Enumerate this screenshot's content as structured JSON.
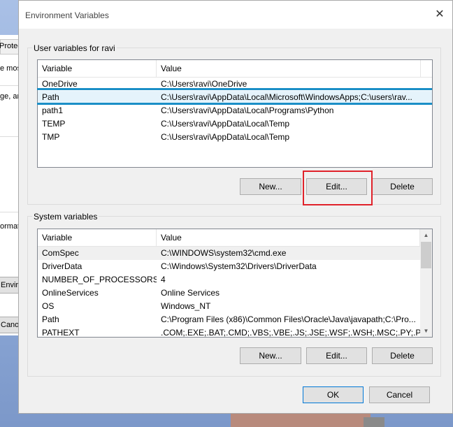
{
  "window": {
    "title": "Environment Variables",
    "close_glyph": "✕"
  },
  "behind_window": {
    "tab_label": "Protec",
    "texts": [
      "e mos",
      "ge, ar",
      "ormati"
    ],
    "buttons": [
      "Envir",
      "Cano"
    ]
  },
  "user_vars": {
    "group_label": "User variables for ravi",
    "columns": [
      "Variable",
      "Value"
    ],
    "rows": [
      {
        "variable": "OneDrive",
        "value": "C:\\Users\\ravi\\OneDrive"
      },
      {
        "variable": "Path",
        "value": "C:\\Users\\ravi\\AppData\\Local\\Microsoft\\WindowsApps;C:\\users\\rav..."
      },
      {
        "variable": "path1",
        "value": "C:\\Users\\ravi\\AppData\\Local\\Programs\\Python"
      },
      {
        "variable": "TEMP",
        "value": "C:\\Users\\ravi\\AppData\\Local\\Temp"
      },
      {
        "variable": "TMP",
        "value": "C:\\Users\\ravi\\AppData\\Local\\Temp"
      }
    ],
    "selected_row": "Path",
    "buttons": {
      "new": "New...",
      "edit": "Edit...",
      "delete": "Delete"
    }
  },
  "system_vars": {
    "group_label": "System variables",
    "columns": [
      "Variable",
      "Value"
    ],
    "rows": [
      {
        "variable": "ComSpec",
        "value": "C:\\WINDOWS\\system32\\cmd.exe"
      },
      {
        "variable": "DriverData",
        "value": "C:\\Windows\\System32\\Drivers\\DriverData"
      },
      {
        "variable": "NUMBER_OF_PROCESSORS",
        "value": "4"
      },
      {
        "variable": "OnlineServices",
        "value": "Online Services"
      },
      {
        "variable": "OS",
        "value": "Windows_NT"
      },
      {
        "variable": "Path",
        "value": "C:\\Program Files (x86)\\Common Files\\Oracle\\Java\\javapath;C:\\Pro..."
      },
      {
        "variable": "PATHEXT",
        "value": ".COM;.EXE;.BAT;.CMD;.VBS;.VBE;.JS;.JSE;.WSF;.WSH;.MSC;.PY;.PYW"
      }
    ],
    "buttons": {
      "new": "New...",
      "edit": "Edit...",
      "delete": "Delete"
    },
    "scroll_up_glyph": "▲",
    "scroll_down_glyph": "▼"
  },
  "footer": {
    "ok": "OK",
    "cancel": "Cancel"
  },
  "colors": {
    "highlight_line": "#1b8fc7",
    "annotation_box": "#e0222a",
    "focus_border": "#0078d7"
  }
}
